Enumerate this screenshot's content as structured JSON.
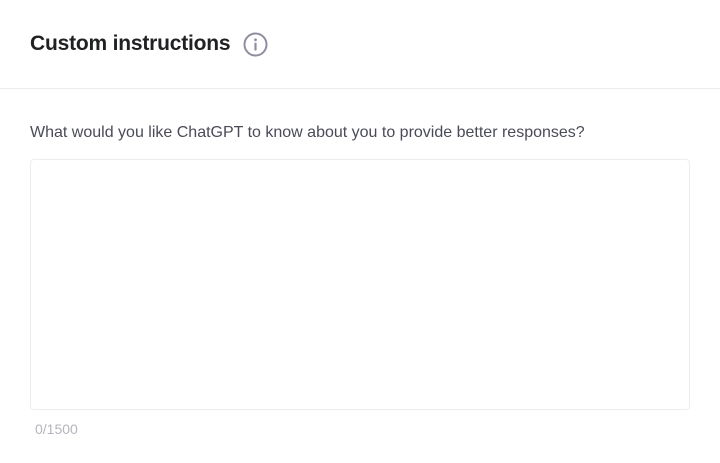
{
  "dialog": {
    "title": "Custom instructions",
    "info_icon": "info-circle-icon"
  },
  "field": {
    "question": "What would you like ChatGPT to know about you to provide better responses?",
    "value": "",
    "placeholder": "",
    "counter": "0/1500"
  },
  "colors": {
    "title": "#202123",
    "question": "#4a4b57",
    "counter": "#b4b4bd",
    "border": "#ececf1"
  }
}
